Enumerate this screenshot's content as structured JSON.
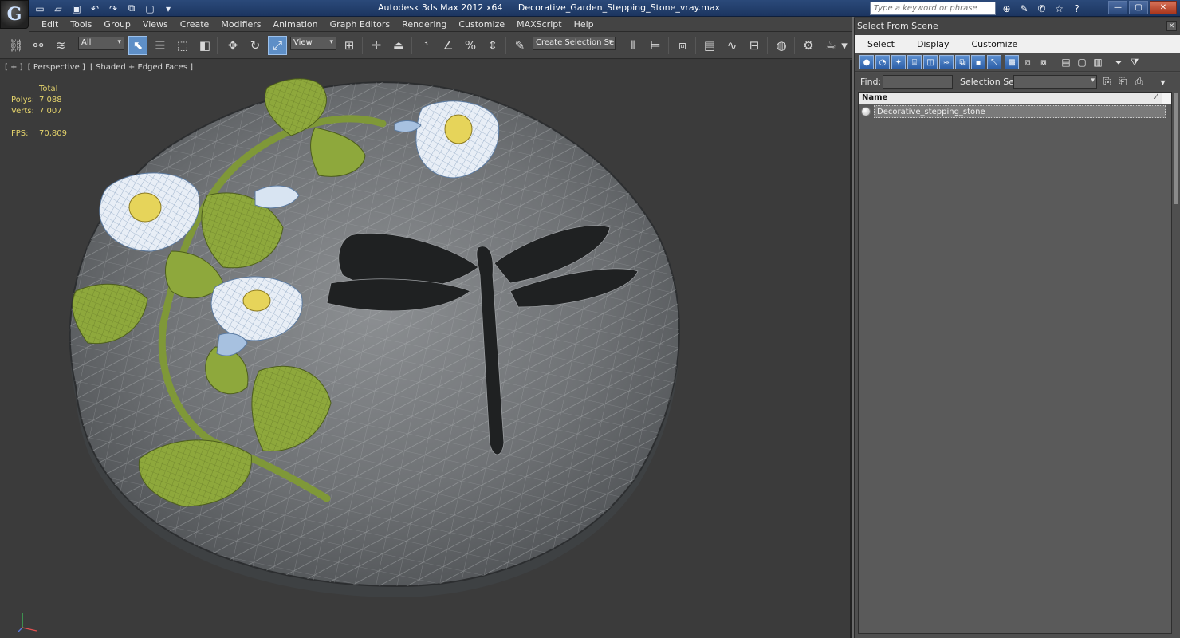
{
  "titlebar": {
    "app_name": "Autodesk 3ds Max  2012 x64",
    "file_name": "Decorative_Garden_Stepping_Stone_vray.max",
    "search_placeholder": "Type a keyword or phrase"
  },
  "menubar": {
    "items": [
      "Edit",
      "Tools",
      "Group",
      "Views",
      "Create",
      "Modifiers",
      "Animation",
      "Graph Editors",
      "Rendering",
      "Customize",
      "MAXScript",
      "Help"
    ]
  },
  "toolbar": {
    "selection_filter": "All",
    "reference_coord": "View",
    "selection_set": "Create Selection Se"
  },
  "viewport": {
    "labels": [
      "[ + ]",
      "[ Perspective ]",
      "[ Shaded + Edged Faces ]"
    ],
    "stats": {
      "header": "Total",
      "polys_label": "Polys:",
      "polys_value": "7 088",
      "verts_label": "Verts:",
      "verts_value": "7 007",
      "fps_label": "FPS:",
      "fps_value": "70,809"
    }
  },
  "panel": {
    "title": "Select From Scene",
    "menu": [
      "Select",
      "Display",
      "Customize"
    ],
    "find_label": "Find:",
    "selection_set_label": "Selection Set:",
    "column_name": "Name",
    "objects": [
      "Decorative_stepping_stone"
    ]
  },
  "colors": {
    "titlebar": "#1c3560",
    "active_tool": "#5e8fc7",
    "stats_text": "#e3d26b",
    "leaf_green": "#8ea83c",
    "flower_center": "#e6d45a"
  }
}
